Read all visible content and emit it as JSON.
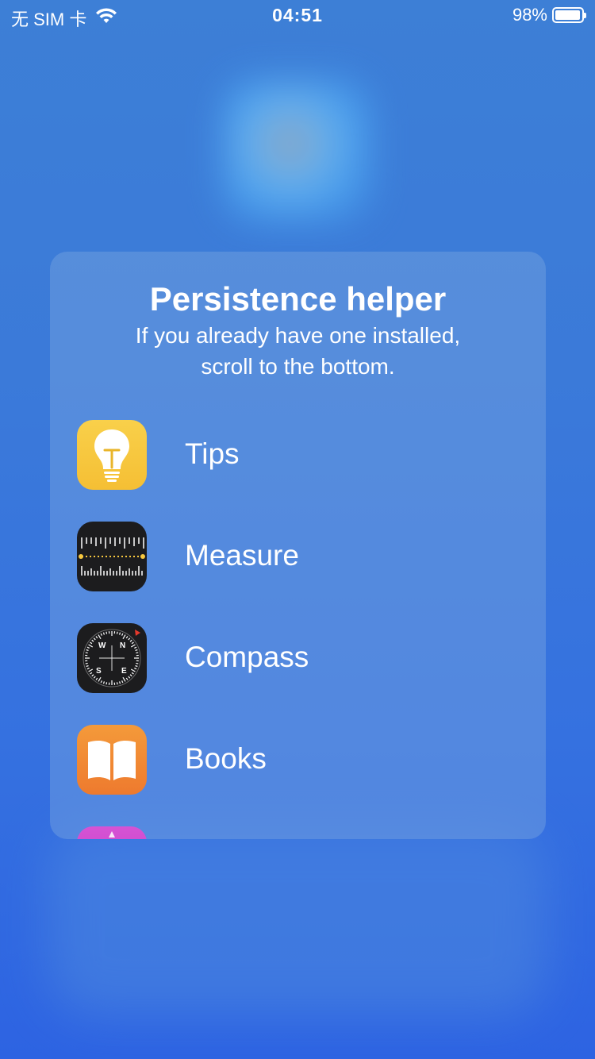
{
  "status_bar": {
    "carrier": "无 SIM 卡",
    "time": "04:51",
    "battery_percent": "98%",
    "battery_level": 0.98
  },
  "card": {
    "title": "Persistence helper",
    "subtitle_line1": "If you already have one installed,",
    "subtitle_line2": "scroll to the bottom."
  },
  "apps": [
    {
      "label": "Tips",
      "icon": "tips-lightbulb-icon",
      "color": "#F7C83F"
    },
    {
      "label": "Measure",
      "icon": "measure-ruler-icon",
      "color": "#1C1C1E"
    },
    {
      "label": "Compass",
      "icon": "compass-icon",
      "color": "#1C1C1E"
    },
    {
      "label": "Books",
      "icon": "books-open-book-icon",
      "color": "#EF832F"
    }
  ],
  "colors": {
    "background_top": "#3D7FD6",
    "background_bottom": "#2D63E2",
    "text": "#FFFFFF"
  }
}
